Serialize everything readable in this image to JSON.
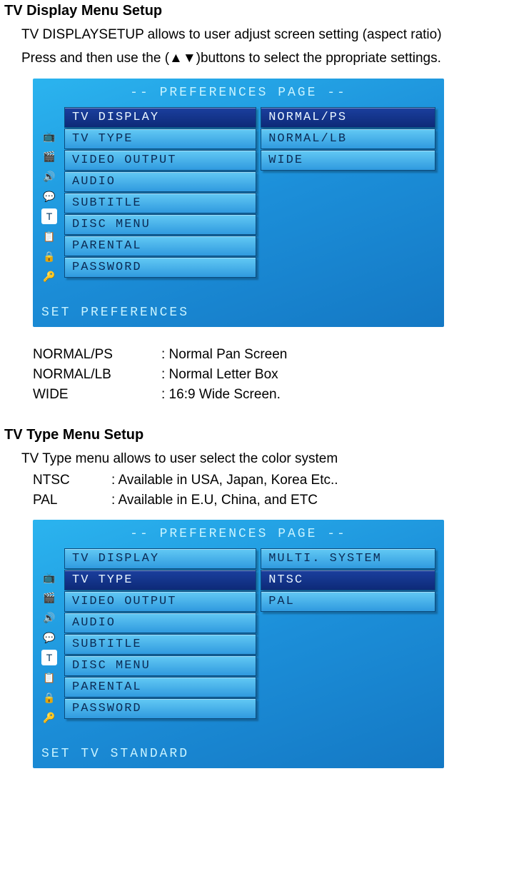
{
  "section1": {
    "title": "TV Display Menu Setup",
    "p1": "TV DISPLAYSETUP allows to user adjust screen setting (aspect ratio)",
    "p2": "Press and then use the (▲▼)buttons to select the ppropriate settings."
  },
  "osd1": {
    "title": "-- PREFERENCES PAGE --",
    "left": [
      "TV DISPLAY",
      "TV TYPE",
      "VIDEO OUTPUT",
      "AUDIO",
      "SUBTITLE",
      "DISC MENU",
      "PARENTAL",
      "PASSWORD"
    ],
    "selectedLeft": "TV DISPLAY",
    "right": [
      "NORMAL/PS",
      "NORMAL/LB",
      "WIDE"
    ],
    "selectedRight": "NORMAL/PS",
    "footer": "SET PREFERENCES",
    "icons": [
      "📺",
      "🎬",
      "🔊",
      "💬",
      "T",
      "📋",
      "🔒",
      "🔑"
    ]
  },
  "defs1": [
    {
      "term": "NORMAL/PS",
      "val": ": Normal Pan Screen"
    },
    {
      "term": "NORMAL/LB",
      "val": ": Normal Letter Box"
    },
    {
      "term": "WIDE",
      "val": ": 16:9 Wide Screen."
    }
  ],
  "section2": {
    "title": "TV Type Menu Setup",
    "p1": "TV Type menu allows to user select the color system"
  },
  "defs2": [
    {
      "term": "NTSC",
      "val": ": Available in USA, Japan, Korea Etc.."
    },
    {
      "term": "PAL",
      "val": ": Available in E.U, China, and ETC"
    }
  ],
  "osd2": {
    "title": "-- PREFERENCES PAGE --",
    "left": [
      "TV DISPLAY",
      "TV TYPE",
      "VIDEO OUTPUT",
      "AUDIO",
      "SUBTITLE",
      "DISC MENU",
      "PARENTAL",
      "PASSWORD"
    ],
    "selectedLeft": "TV TYPE",
    "right": [
      "MULTI. SYSTEM",
      "NTSC",
      "PAL"
    ],
    "selectedRight": "NTSC",
    "footer": "SET TV STANDARD",
    "icons": [
      "📺",
      "🎬",
      "🔊",
      "💬",
      "T",
      "📋",
      "🔒",
      "🔑"
    ]
  }
}
